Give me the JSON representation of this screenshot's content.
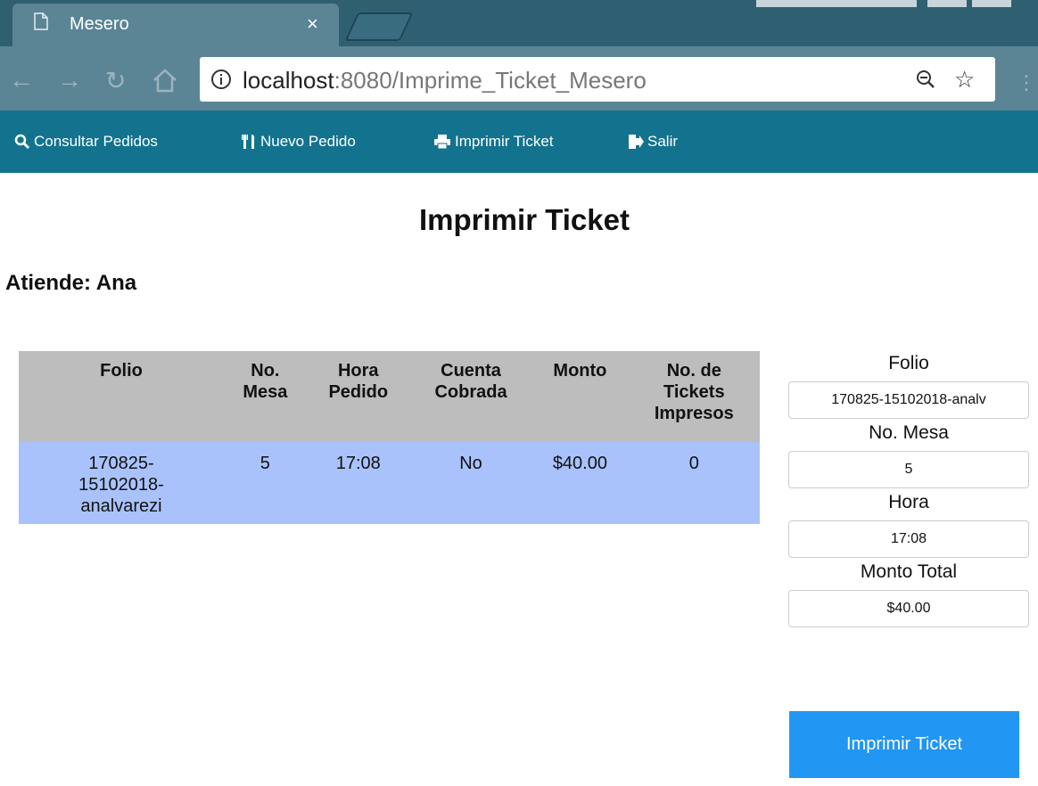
{
  "browser": {
    "tab_title": "Mesero",
    "tab_close": "×",
    "url_host": "localhost",
    "url_rest": ":8080/Imprime_Ticket_Mesero"
  },
  "nav": {
    "items": [
      {
        "label": "Consultar Pedidos",
        "icon": "search-icon"
      },
      {
        "label": "Nuevo Pedido",
        "icon": "cutlery-icon"
      },
      {
        "label": "Imprimir Ticket",
        "icon": "print-icon"
      },
      {
        "label": "Salir",
        "icon": "logout-icon"
      }
    ]
  },
  "page": {
    "title": "Imprimir Ticket",
    "attendee": "Atiende: Ana"
  },
  "table": {
    "headers": {
      "folio": "Folio",
      "mesa_1": "No.",
      "mesa_2": "Mesa",
      "hora_1": "Hora",
      "hora_2": "Pedido",
      "cuenta_1": "Cuenta",
      "cuenta_2": "Cobrada",
      "monto": "Monto",
      "tickets_1": "No. de",
      "tickets_2": "Tickets",
      "tickets_3": "Impresos"
    },
    "rows": [
      {
        "folio_1": "170825-",
        "folio_2": "15102018-",
        "folio_3": "analvarezi",
        "mesa": "5",
        "hora": "17:08",
        "cobrada": "No",
        "monto": "$40.00",
        "tickets": "0"
      }
    ]
  },
  "form": {
    "folio_label": "Folio",
    "folio_value": "170825-15102018-analv",
    "mesa_label": "No. Mesa",
    "mesa_value": "5",
    "hora_label": "Hora",
    "hora_value": "17:08",
    "monto_label": "Monto Total",
    "monto_value": "$40.00",
    "submit_label": "Imprimir Ticket"
  },
  "colors": {
    "navbar": "#13738e",
    "table_header": "#bdbdbd",
    "table_row": "#aac2fb",
    "button": "#2196f3"
  }
}
